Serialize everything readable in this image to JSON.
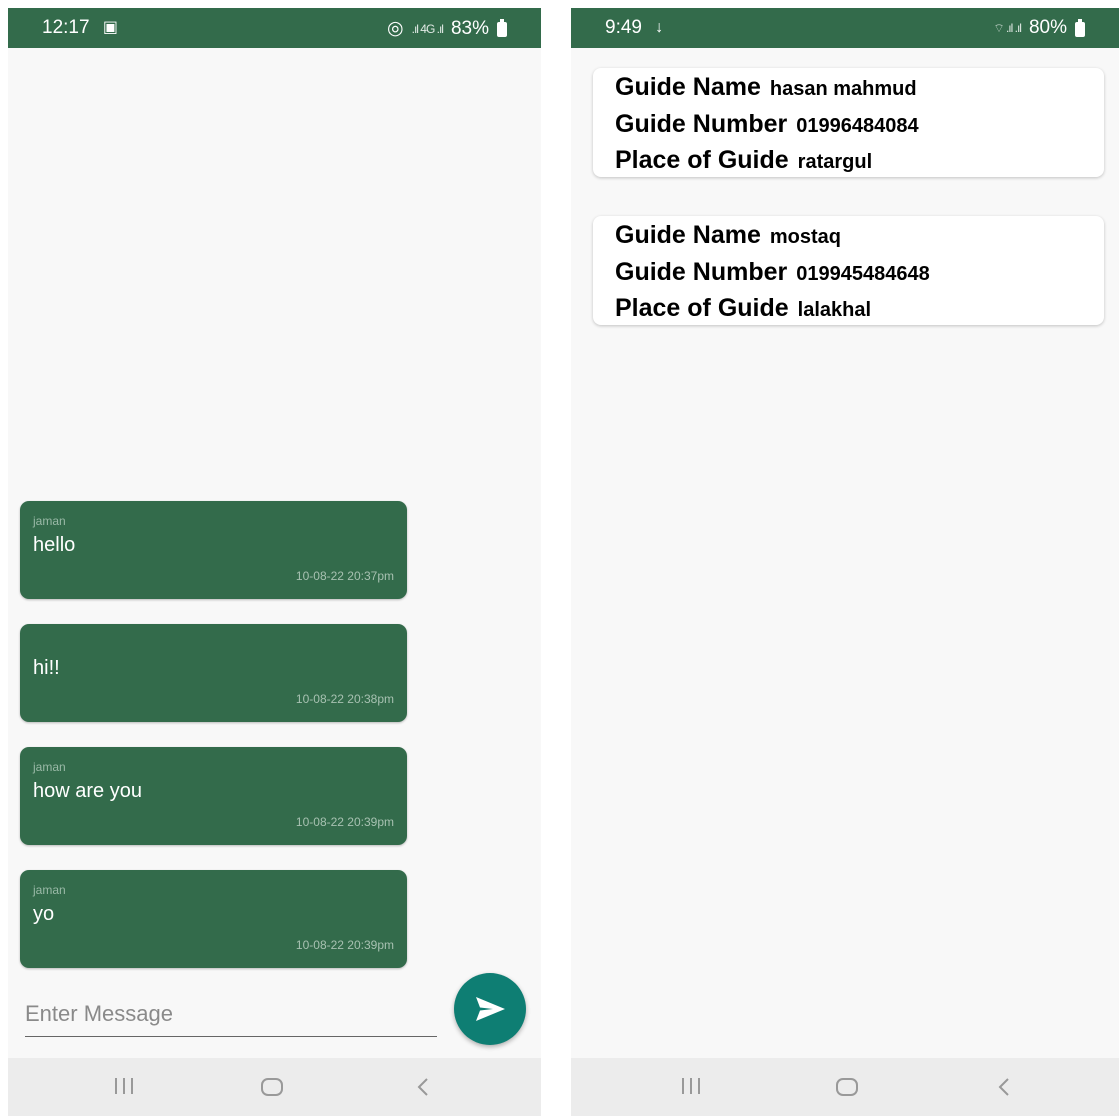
{
  "left_phone": {
    "status": {
      "time": "12:17",
      "battery": "83%"
    },
    "messages": [
      {
        "sender": "jaman",
        "text": "hello",
        "timestamp": "10-08-22 20:37pm"
      },
      {
        "sender": "",
        "text": "hi!!",
        "timestamp": "10-08-22 20:38pm"
      },
      {
        "sender": "jaman",
        "text": "how are you",
        "timestamp": "10-08-22 20:39pm"
      },
      {
        "sender": "jaman",
        "text": "yo",
        "timestamp": "10-08-22 20:39pm"
      }
    ],
    "input": {
      "placeholder": "Enter Message"
    },
    "colors": {
      "header": "#336b4b",
      "bubble": "#336b4b",
      "send_button": "#0e7e73"
    },
    "icons": {
      "send": "send-icon"
    }
  },
  "right_phone": {
    "status": {
      "time": "9:49",
      "battery": "80%"
    },
    "guides": [
      {
        "name_label": "Guide Name",
        "name": "hasan mahmud",
        "number_label": "Guide Number",
        "number": "01996484084",
        "place_label": "Place of Guide",
        "place": "ratargul"
      },
      {
        "name_label": "Guide Name",
        "name": "mostaq",
        "number_label": "Guide Number",
        "number": "019945484648",
        "place_label": "Place of Guide",
        "place": "lalakhal"
      }
    ]
  },
  "navigation": {
    "recents": "recents-icon",
    "home": "home-icon",
    "back": "back-icon"
  }
}
